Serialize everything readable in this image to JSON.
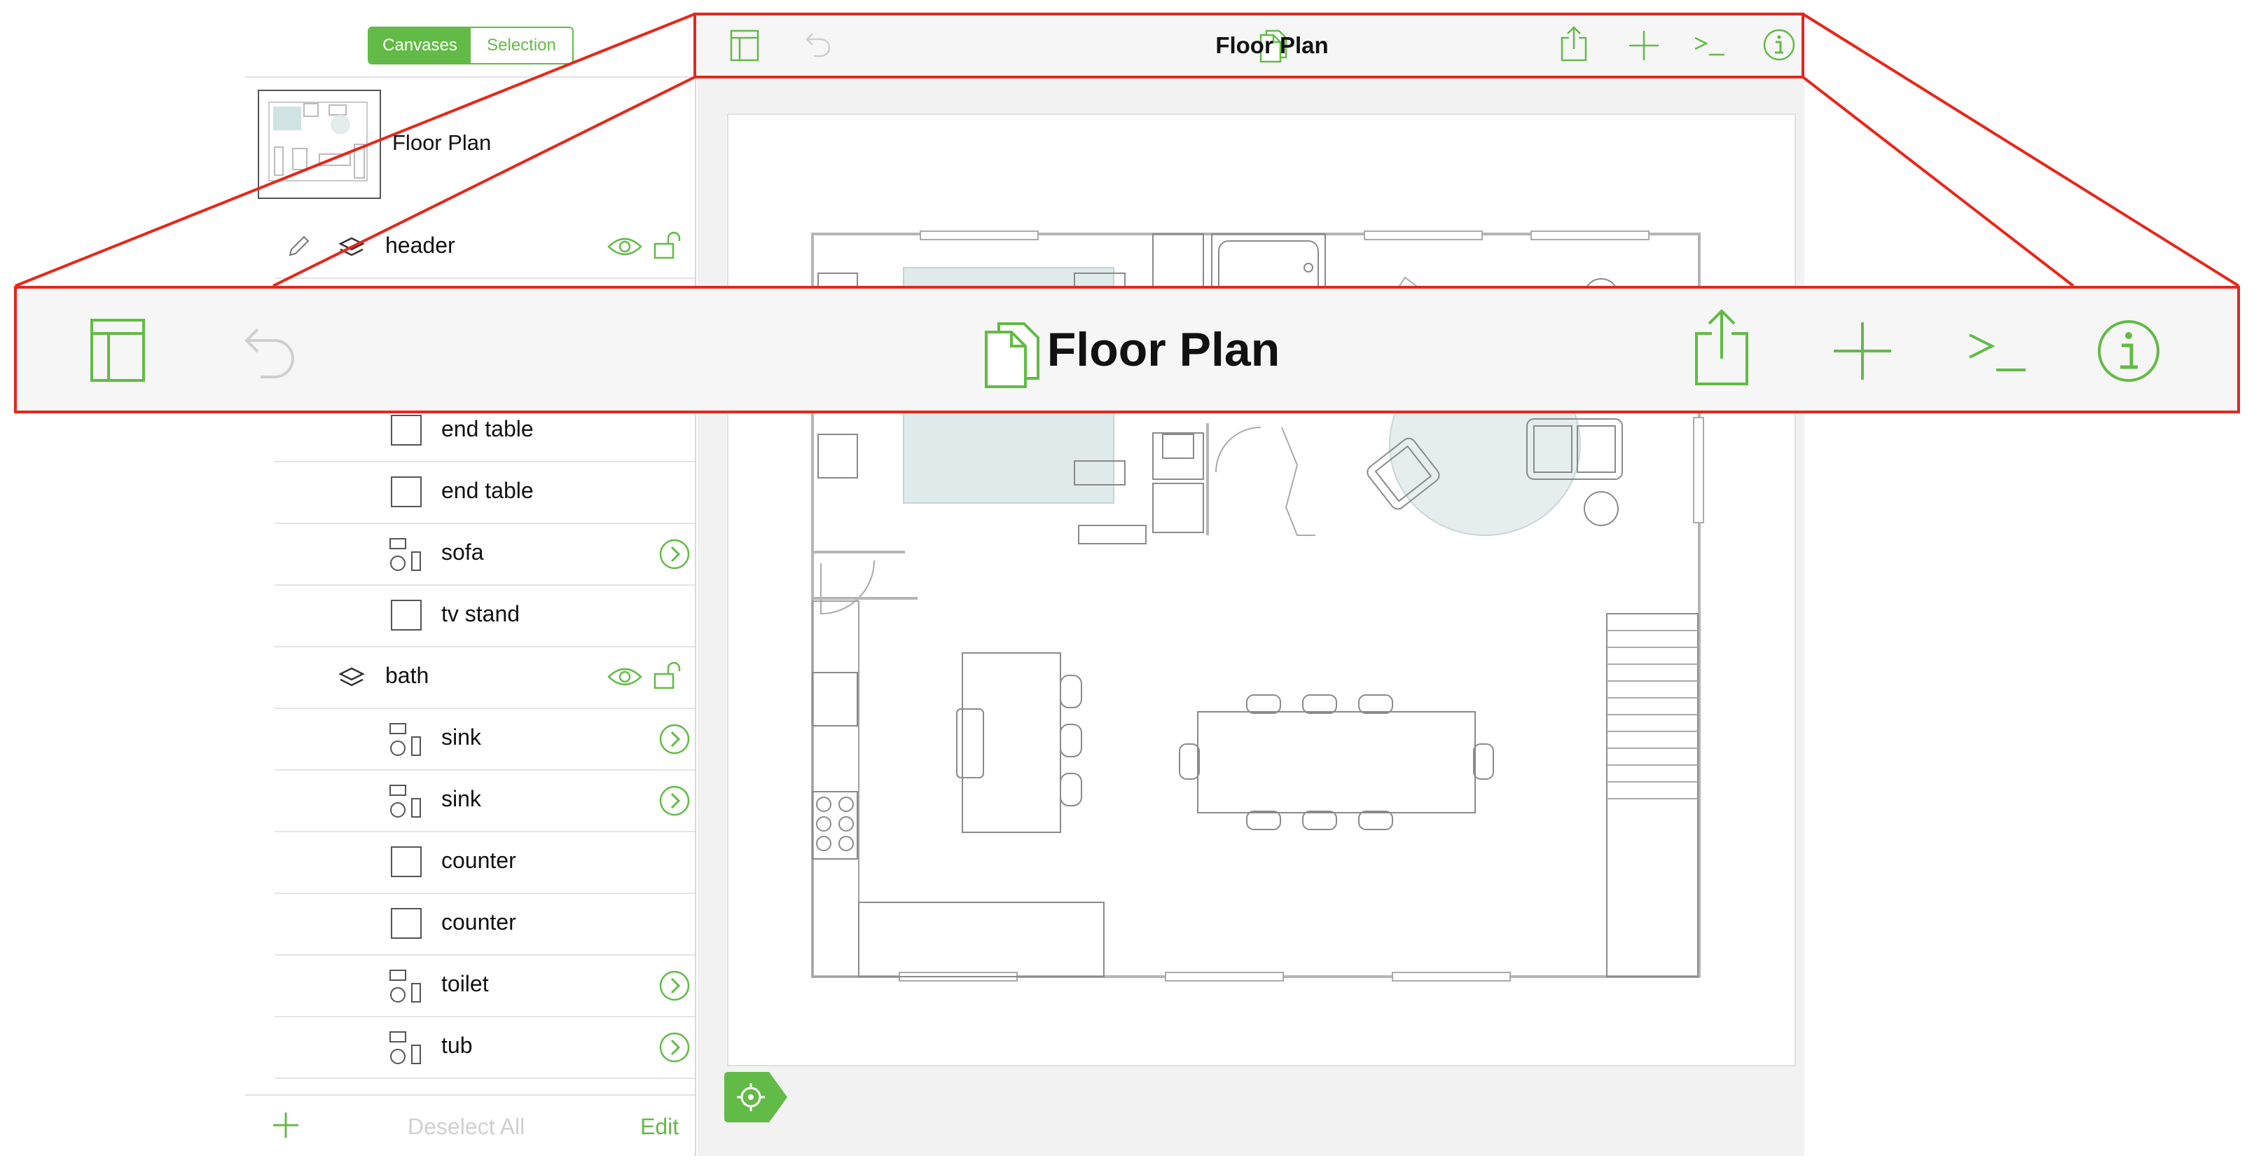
{
  "sidebar": {
    "segments": [
      {
        "label": "Canvases",
        "active": true
      },
      {
        "label": "Selection",
        "active": false
      }
    ],
    "canvas": {
      "name": "Floor Plan"
    },
    "rows": [
      {
        "kind": "layer",
        "label": "header",
        "pencil": true
      },
      {
        "kind": "object",
        "label": "end table",
        "shape": "square"
      },
      {
        "kind": "object",
        "label": "end table",
        "shape": "square"
      },
      {
        "kind": "object",
        "label": "sofa",
        "shape": "group"
      },
      {
        "kind": "object",
        "label": "tv stand",
        "shape": "square"
      },
      {
        "kind": "layer",
        "label": "bath",
        "pencil": false
      },
      {
        "kind": "object",
        "label": "sink",
        "shape": "group"
      },
      {
        "kind": "object",
        "label": "sink",
        "shape": "group"
      },
      {
        "kind": "object",
        "label": "counter",
        "shape": "square"
      },
      {
        "kind": "object",
        "label": "counter",
        "shape": "square"
      },
      {
        "kind": "object",
        "label": "toilet",
        "shape": "group"
      },
      {
        "kind": "object",
        "label": "tub",
        "shape": "group"
      }
    ],
    "bottom": {
      "deselect_label": "Deselect All",
      "edit_label": "Edit"
    }
  },
  "toolbar": {
    "title": "Floor Plan",
    "icons": [
      "sidebar-toggle-icon",
      "undo-icon",
      "document-icon",
      "share-icon",
      "add-icon",
      "console-icon",
      "info-icon"
    ]
  },
  "callout": {
    "title": "Floor Plan",
    "border_color": "#e8261a"
  },
  "colors": {
    "accent": "#62bb46",
    "disabled": "#cfcfcf",
    "highlight": "#e8261a",
    "rug": "#deebea"
  }
}
